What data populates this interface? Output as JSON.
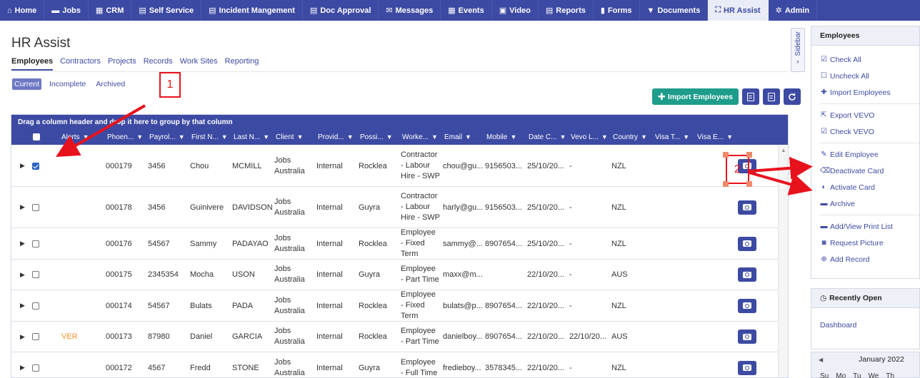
{
  "nav": [
    {
      "label": "Home",
      "icon": "home-icon",
      "glyph": "⌂"
    },
    {
      "label": "Jobs",
      "icon": "folder-icon",
      "glyph": "▬"
    },
    {
      "label": "CRM",
      "icon": "building-icon",
      "glyph": "▦"
    },
    {
      "label": "Self Service",
      "icon": "form-icon",
      "glyph": "▤"
    },
    {
      "label": "Incident Mangement",
      "icon": "list-icon",
      "glyph": "▤"
    },
    {
      "label": "Doc Approval",
      "icon": "document-icon",
      "glyph": "▤"
    },
    {
      "label": "Messages",
      "icon": "envelope-icon",
      "glyph": "✉"
    },
    {
      "label": "Events",
      "icon": "calendar-icon",
      "glyph": "▦"
    },
    {
      "label": "Video",
      "icon": "video-icon",
      "glyph": "▣"
    },
    {
      "label": "Reports",
      "icon": "chart-icon",
      "glyph": "▤"
    },
    {
      "label": "Forms",
      "icon": "file-icon",
      "glyph": "▮"
    },
    {
      "label": "Documents",
      "icon": "filter-icon",
      "glyph": "▼"
    },
    {
      "label": "HR Assist",
      "icon": "org-chart-icon",
      "glyph": "⛶",
      "active": true
    },
    {
      "label": "Admin",
      "icon": "gear-icon",
      "glyph": "✲"
    }
  ],
  "page_title": "HR Assist",
  "tabs": [
    {
      "label": "Employees",
      "active": true
    },
    {
      "label": "Contractors"
    },
    {
      "label": "Projects"
    },
    {
      "label": "Records"
    },
    {
      "label": "Work Sites"
    },
    {
      "label": "Reporting"
    }
  ],
  "subfilters": [
    {
      "label": "Current",
      "active": true
    },
    {
      "label": "Incomplete"
    },
    {
      "label": "Archived"
    }
  ],
  "toolbar": {
    "import_label": "Import Employees"
  },
  "grid": {
    "group_hint": "Drag a column header and drop it here to group by that column",
    "columns": [
      "Alerts",
      "Phoen...",
      "Payrol...",
      "First N...",
      "Last N...",
      "Client",
      "Provid...",
      "Possi...",
      "Worke...",
      "Email",
      "Mobile",
      "Date C...",
      "Vevo L...",
      "Country",
      "Visa T...",
      "Visa E..."
    ],
    "rows": [
      {
        "checked": true,
        "alert": "",
        "phoenix": "000179",
        "payroll": "3456",
        "first": "Chou",
        "last": "MCMILL",
        "client": "Jobs Australia",
        "provider": "Internal",
        "position": "Rocklea",
        "worker": "Contractor - Labour Hire - SWP",
        "email": "chou@gu...",
        "mobile": "9156503...",
        "date": "25/10/20...",
        "vevo": "-",
        "country": "NZL"
      },
      {
        "checked": false,
        "alert": "",
        "phoenix": "000178",
        "payroll": "3456",
        "first": "Guinivere",
        "last": "DAVIDSON",
        "client": "Jobs Australia",
        "provider": "Internal",
        "position": "Guyra",
        "worker": "Contractor - Labour Hire - SWP",
        "email": "harly@gu...",
        "mobile": "9156503...",
        "date": "25/10/20...",
        "vevo": "-",
        "country": "NZL"
      },
      {
        "checked": false,
        "alert": "",
        "phoenix": "000176",
        "payroll": "54567",
        "first": "Sammy",
        "last": "PADAYAO",
        "client": "Jobs Australia",
        "provider": "Internal",
        "position": "Rocklea",
        "worker": "Employee - Fixed Term",
        "email": "sammy@...",
        "mobile": "8907654...",
        "date": "25/10/20...",
        "vevo": "-",
        "country": "NZL"
      },
      {
        "checked": false,
        "alert": "",
        "phoenix": "000175",
        "payroll": "2345354",
        "first": "Mocha",
        "last": "USON",
        "client": "Jobs Australia",
        "provider": "Internal",
        "position": "Guyra",
        "worker": "Employee - Part Time",
        "email": "maxx@m...",
        "mobile": "",
        "date": "22/10/20...",
        "vevo": "-",
        "country": "AUS"
      },
      {
        "checked": false,
        "alert": "",
        "phoenix": "000174",
        "payroll": "54567",
        "first": "Bulats",
        "last": "PADA",
        "client": "Jobs Australia",
        "provider": "Internal",
        "position": "Rocklea",
        "worker": "Employee - Fixed Term",
        "email": "bulats@p...",
        "mobile": "8907654...",
        "date": "22/10/20...",
        "vevo": "-",
        "country": "NZL"
      },
      {
        "checked": false,
        "alert": "VER",
        "phoenix": "000173",
        "payroll": "87980",
        "first": "Daniel",
        "last": "GARCIA",
        "client": "Jobs Australia",
        "provider": "Internal",
        "position": "Rocklea",
        "worker": "Employee - Part Time",
        "email": "danielboy...",
        "mobile": "8907654...",
        "date": "22/10/20...",
        "vevo": "22/10/20...",
        "country": "AUS"
      },
      {
        "checked": false,
        "alert": "",
        "phoenix": "000172",
        "payroll": "4567",
        "first": "Fredd",
        "last": "STONE",
        "client": "Jobs Australia",
        "provider": "Internal",
        "position": "Guyra",
        "worker": "Employee - Full Time",
        "email": "fredieboy...",
        "mobile": "3578345...",
        "date": "22/10/20...",
        "vevo": "-",
        "country": "NZL"
      }
    ]
  },
  "sidebar_toggle": {
    "label": "Sidebar"
  },
  "employees_panel": {
    "title": "Employees",
    "groups": [
      [
        {
          "label": "Check All",
          "icon": "check-square-icon",
          "glyph": "☑"
        },
        {
          "label": "Uncheck All",
          "icon": "square-icon",
          "glyph": "☐"
        },
        {
          "label": "Import Employees",
          "icon": "plus-icon",
          "glyph": "✚"
        }
      ],
      [
        {
          "label": "Export VEVO",
          "icon": "export-icon",
          "glyph": "⇱"
        },
        {
          "label": "Check VEVO",
          "icon": "check-square-icon",
          "glyph": "☑"
        }
      ],
      [
        {
          "label": "Edit Employee",
          "icon": "edit-icon",
          "glyph": "✎"
        },
        {
          "label": "Deactivate Card",
          "icon": "eraser-icon",
          "glyph": "⌫"
        },
        {
          "label": "Activate Card",
          "icon": "half-circle-icon",
          "glyph": "◐"
        },
        {
          "label": "Archive",
          "icon": "folder-icon",
          "glyph": "▬"
        }
      ],
      [
        {
          "label": "Add/View Print List",
          "icon": "card-icon",
          "glyph": "▬"
        },
        {
          "label": "Request Picture",
          "icon": "camera-icon",
          "glyph": "◙"
        },
        {
          "label": "Add Record",
          "icon": "plus-circle-icon",
          "glyph": "⊕"
        }
      ]
    ]
  },
  "recent_panel": {
    "title": "Recently Open",
    "title_icon": "clock-icon",
    "glyph": "◷",
    "items": [
      "Dashboard"
    ]
  },
  "calendar": {
    "month": "January 2022",
    "days": [
      "Su",
      "Mo",
      "Tu",
      "We",
      "Th"
    ]
  },
  "annotations": {
    "box1": "1",
    "box2": "2"
  },
  "colors": {
    "nav": "#3d4aa3",
    "teal": "#1e9d8b",
    "annotation": "#e8121d",
    "alert": "#f0922d"
  }
}
